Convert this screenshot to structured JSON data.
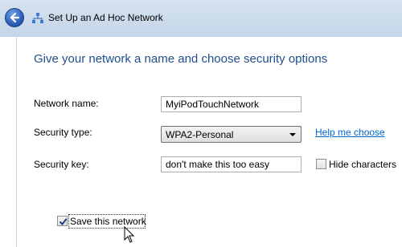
{
  "window": {
    "title": "Set Up an Ad Hoc Network"
  },
  "main": {
    "heading": "Give your network a name and choose security options"
  },
  "form": {
    "network_name": {
      "label": "Network name:",
      "value": "MyiPodTouchNetwork"
    },
    "security_type": {
      "label": "Security type:",
      "value": "WPA2-Personal",
      "help_link": "Help me choose"
    },
    "security_key": {
      "label": "Security key:",
      "value": "don't make this too easy",
      "hide_label": "Hide characters",
      "hide_checked": false
    },
    "save_network": {
      "label": "Save this network",
      "checked": true
    }
  },
  "colors": {
    "heading": "#1e4e8c",
    "link": "#0066cc",
    "titlebar": "#c3d5e8"
  }
}
